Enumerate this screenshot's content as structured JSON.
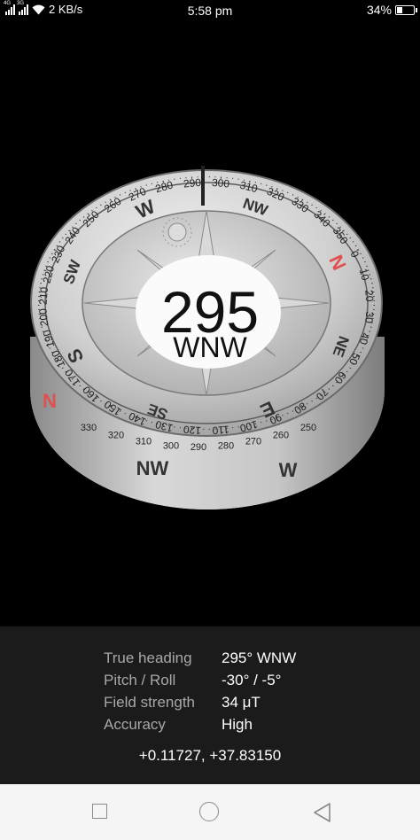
{
  "status_bar": {
    "network_speed": "2 KB/s",
    "time": "5:58 pm",
    "battery_percent": "34%",
    "battery_level": 0.34,
    "sim1_label": "4G",
    "sim2_label": "3G"
  },
  "compass": {
    "heading_value": "295",
    "heading_direction": "WNW",
    "cardinal_labels": [
      "W",
      "NW",
      "N",
      "NE",
      "E",
      "SE",
      "S",
      "SW"
    ],
    "outer_ring_ticks": [
      "210",
      "220",
      "230",
      "240",
      "250",
      "260",
      "270",
      "280",
      "290",
      "300",
      "310",
      "320",
      "330",
      "340",
      "350",
      "0",
      "10",
      "20",
      "30",
      "40",
      "50",
      "60",
      "70",
      "80",
      "90",
      "100",
      "110",
      "120",
      "130",
      "140",
      "150",
      "160",
      "170",
      "180",
      "190",
      "200"
    ],
    "side_ring_ticks": [
      "330",
      "320",
      "310",
      "300",
      "290",
      "280",
      "270",
      "260",
      "250"
    ],
    "side_letters": [
      "N",
      "NW",
      "W"
    ],
    "accent_color": "#e05050"
  },
  "info": {
    "rows": [
      {
        "label": "True heading",
        "value": "295° WNW"
      },
      {
        "label": "Pitch / Roll",
        "value": "-30° / -5°"
      },
      {
        "label": "Field strength",
        "value": "34 μT"
      },
      {
        "label": "Accuracy",
        "value": "High"
      }
    ],
    "coordinates": "+0.11727, +37.83150"
  },
  "nav_bar": {
    "recent_icon": "square-icon",
    "home_icon": "circle-icon",
    "back_icon": "triangle-back-icon"
  }
}
